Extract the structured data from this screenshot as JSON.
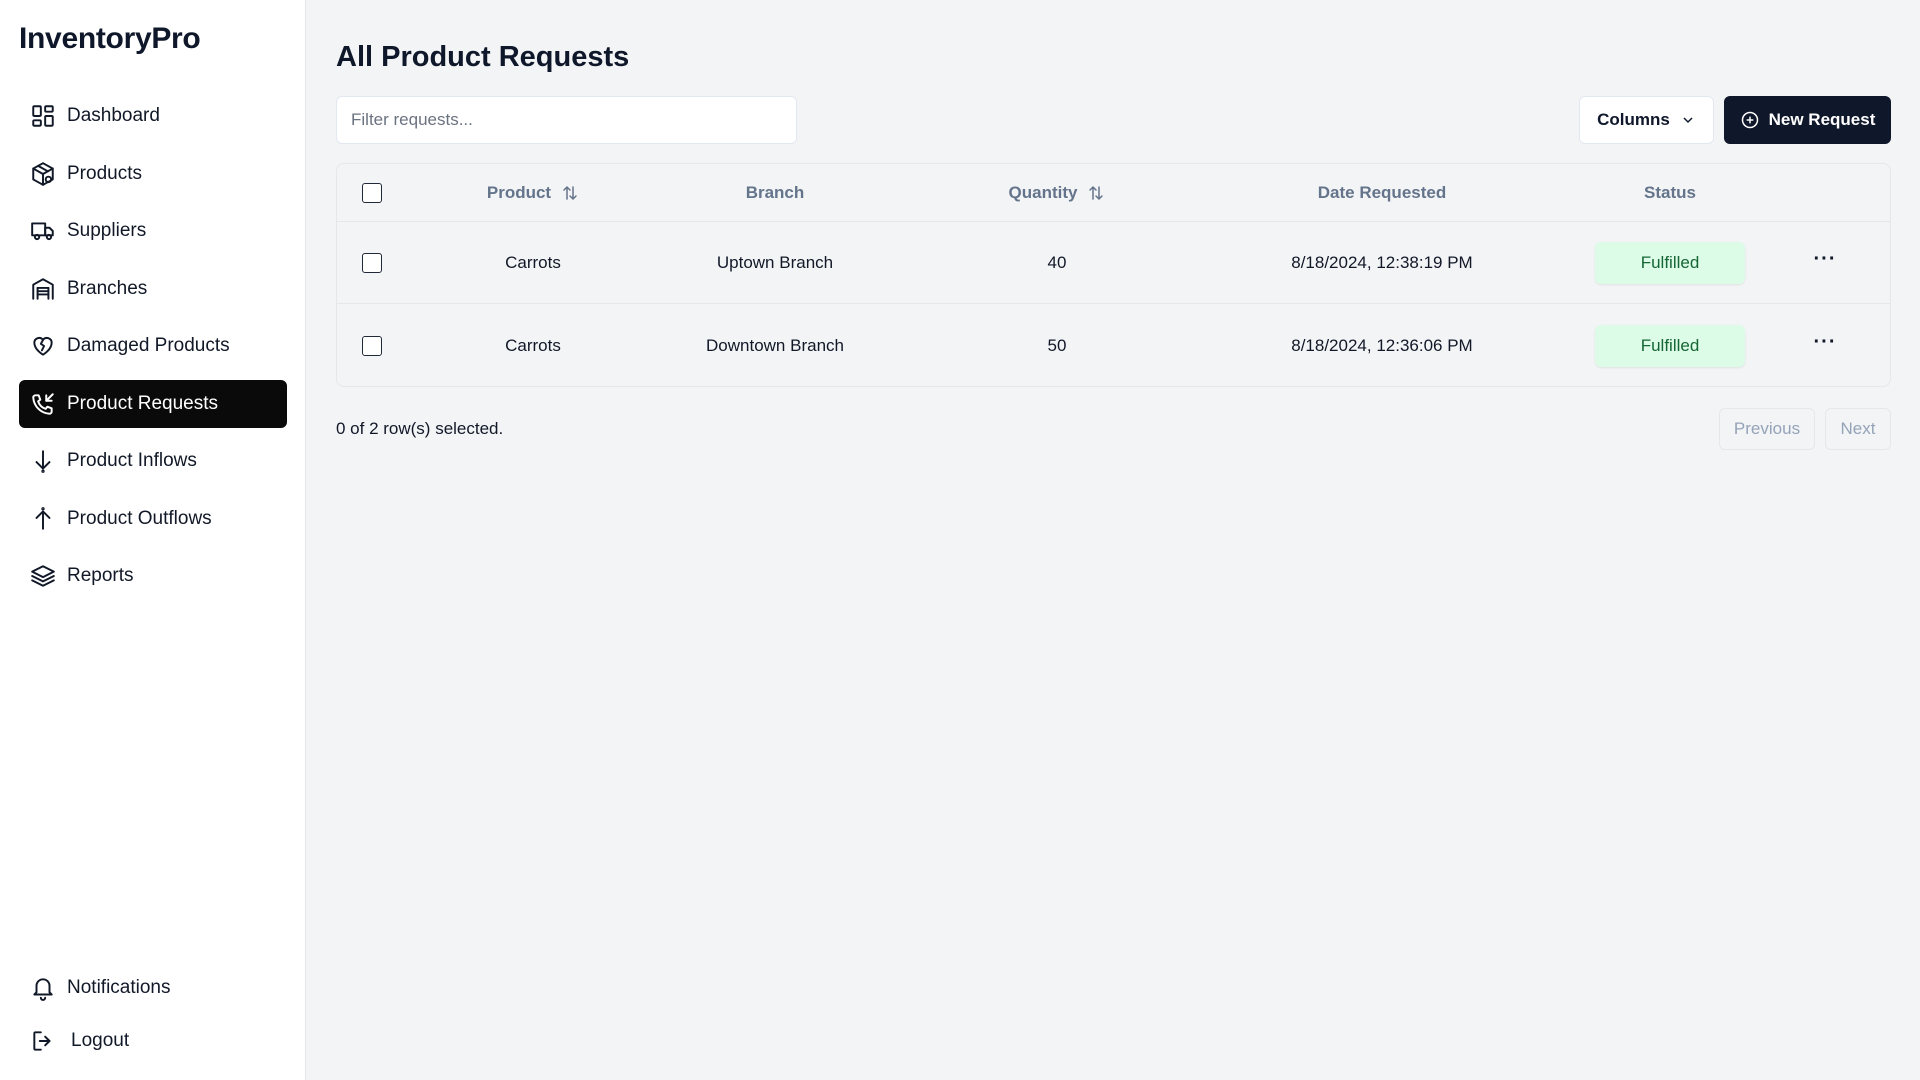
{
  "app": {
    "brand": "InventoryPro"
  },
  "sidebar": {
    "items": [
      {
        "label": "Dashboard",
        "icon": "dashboard-grid-icon"
      },
      {
        "label": "Products",
        "icon": "package-icon"
      },
      {
        "label": "Suppliers",
        "icon": "truck-icon"
      },
      {
        "label": "Branches",
        "icon": "warehouse-icon"
      },
      {
        "label": "Damaged Products",
        "icon": "heart-crack-icon"
      },
      {
        "label": "Product Requests",
        "icon": "phone-incoming-icon",
        "active": true
      },
      {
        "label": "Product Inflows",
        "icon": "arrow-down-icon"
      },
      {
        "label": "Product Outflows",
        "icon": "arrow-up-icon"
      },
      {
        "label": "Reports",
        "icon": "layers-icon"
      }
    ],
    "bottom": [
      {
        "label": "Notifications",
        "icon": "bell-icon"
      },
      {
        "label": "Logout",
        "icon": "logout-icon"
      }
    ]
  },
  "main": {
    "title": "All Product Requests",
    "filter": {
      "placeholder": "Filter requests..."
    },
    "columns_button": "Columns",
    "new_button": "New Request",
    "table": {
      "headers": {
        "product": "Product",
        "branch": "Branch",
        "quantity": "Quantity",
        "date": "Date Requested",
        "status": "Status"
      },
      "rows": [
        {
          "product": "Carrots",
          "branch": "Uptown Branch",
          "quantity": "40",
          "date": "8/18/2024, 12:38:19 PM",
          "status": "Fulfilled",
          "actions": "···"
        },
        {
          "product": "Carrots",
          "branch": "Downtown Branch",
          "quantity": "50",
          "date": "8/18/2024, 12:36:06 PM",
          "status": "Fulfilled",
          "actions": "···"
        }
      ]
    },
    "footer": {
      "selected_text": "0 of 2 row(s) selected.",
      "previous": "Previous",
      "next": "Next"
    }
  },
  "colors": {
    "accent": "#0f172a",
    "active_nav": "#0a0a0a",
    "status_fulfilled_bg": "#dcfce7",
    "status_fulfilled_text": "#166534",
    "background": "#f3f4f6"
  }
}
